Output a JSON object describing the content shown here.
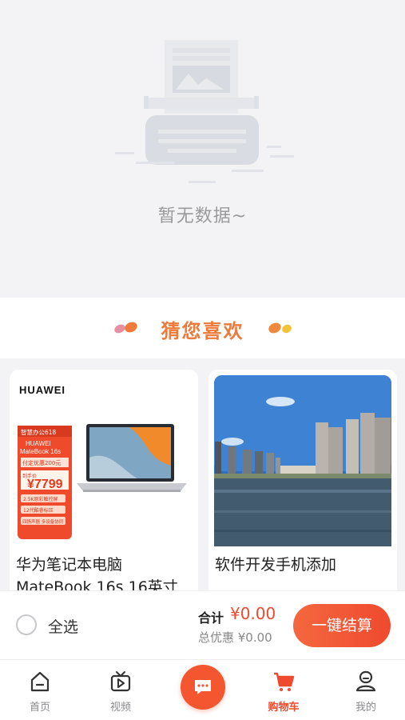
{
  "empty": {
    "text": "暂无数据~"
  },
  "guess": {
    "title": "猜您喜欢"
  },
  "products": [
    {
      "brand": "HUAWEI",
      "promo": [
        "智慧办公618",
        "HUAWEI",
        "MateBook 16s",
        "付定优惠200元",
        "到手价",
        "¥7799",
        "2.5K原彩触控屏",
        "12代酷睿标压",
        "四扬声器 多设备协同"
      ],
      "title": "华为笔记本电脑MateBook 16s 16英寸"
    },
    {
      "title": "软件开发手机添加"
    }
  ],
  "cart": {
    "select_all": "全选",
    "total_label": "合计",
    "total_value": "¥0.00",
    "discount": "总优惠 ¥0.00",
    "checkout": "一键结算"
  },
  "tabs": [
    {
      "label": "首页",
      "icon": "home-icon"
    },
    {
      "label": "视频",
      "icon": "video-icon"
    },
    {
      "label": "",
      "icon": "chat-icon"
    },
    {
      "label": "购物车",
      "icon": "cart-icon"
    },
    {
      "label": "我的",
      "icon": "profile-icon"
    }
  ],
  "colors": {
    "accent": "#ef4a2e",
    "title_orange": "#ee7a3a"
  }
}
